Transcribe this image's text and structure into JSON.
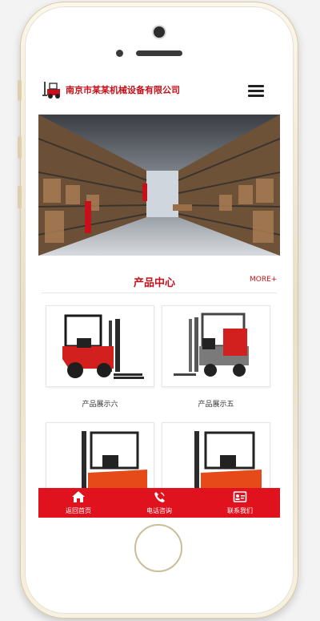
{
  "header": {
    "company_name": "南京市某某机械设备有限公司",
    "logo_icon": "forklift-logo-icon",
    "menu_icon": "hamburger-menu-icon"
  },
  "banner": {
    "image": "warehouse-aisle-photo"
  },
  "products_section": {
    "title": "产品中心",
    "more_label": "MORE+",
    "items": [
      {
        "label": "产品展示六",
        "image": "red-forklift-photo"
      },
      {
        "label": "产品展示五",
        "image": "red-grey-forklift-photo"
      },
      {
        "label": "",
        "image": "orange-forklift-photo"
      },
      {
        "label": "",
        "image": "orange-forklift-photo"
      }
    ]
  },
  "tabbar": {
    "items": [
      {
        "label": "返回首页",
        "icon": "home-icon"
      },
      {
        "label": "电话咨询",
        "icon": "phone-icon"
      },
      {
        "label": "联系我们",
        "icon": "contact-card-icon"
      }
    ]
  },
  "colors": {
    "brand_red": "#c8101a",
    "tabbar_red": "#e0121e"
  }
}
